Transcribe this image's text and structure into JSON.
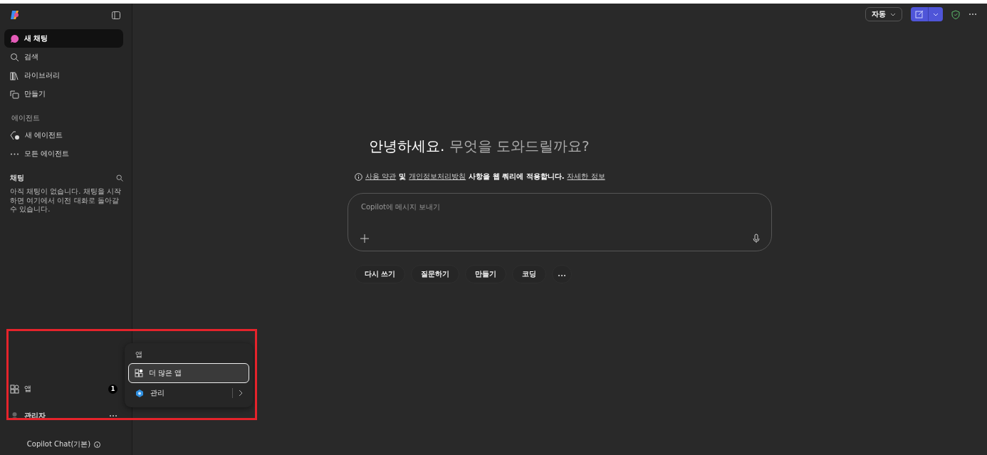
{
  "sidebar": {
    "nav": [
      {
        "label": "새 채팅",
        "selected": true
      },
      {
        "label": "검색",
        "selected": false
      },
      {
        "label": "라이브러리",
        "selected": false
      },
      {
        "label": "만들기",
        "selected": false
      }
    ],
    "agents": {
      "heading": "에이전트",
      "items": [
        {
          "label": "새 에이전트"
        },
        {
          "label": "모든 에이전트"
        }
      ]
    },
    "chats": {
      "heading": "채팅",
      "empty_text": "아직 채팅이 없습니다. 채팅을 시작하면 여기에서 이전 대화로 돌아갈 수 있습니다."
    },
    "apps": {
      "label": "앱",
      "badge": "1"
    },
    "user": {
      "name": "관리자"
    },
    "footer": "Copilot Chat(기본)"
  },
  "top_bar": {
    "mode": "자동"
  },
  "main": {
    "greeting": "안녕하세요.",
    "question": "무엇을 도와드릴까요?",
    "notice": [
      {
        "text": "사용 약관",
        "link": true
      },
      {
        "text": "및",
        "link": false
      },
      {
        "text": "개인정보처리방침",
        "link": true
      },
      {
        "text": "사항을 웹 쿼리에 적용합니다.",
        "link": false
      },
      {
        "text": "자세한 정보",
        "link": true
      }
    ],
    "composer": {
      "placeholder": "Copilot에 메시지 보내기"
    },
    "suggestions": [
      "다시 쓰기",
      "질문하기",
      "만들기",
      "코딩"
    ]
  },
  "apps_menu": {
    "heading": "앱",
    "items": [
      {
        "label": "더 많은 앱",
        "selected": true
      },
      {
        "label": "관리",
        "selected": false
      }
    ]
  }
}
